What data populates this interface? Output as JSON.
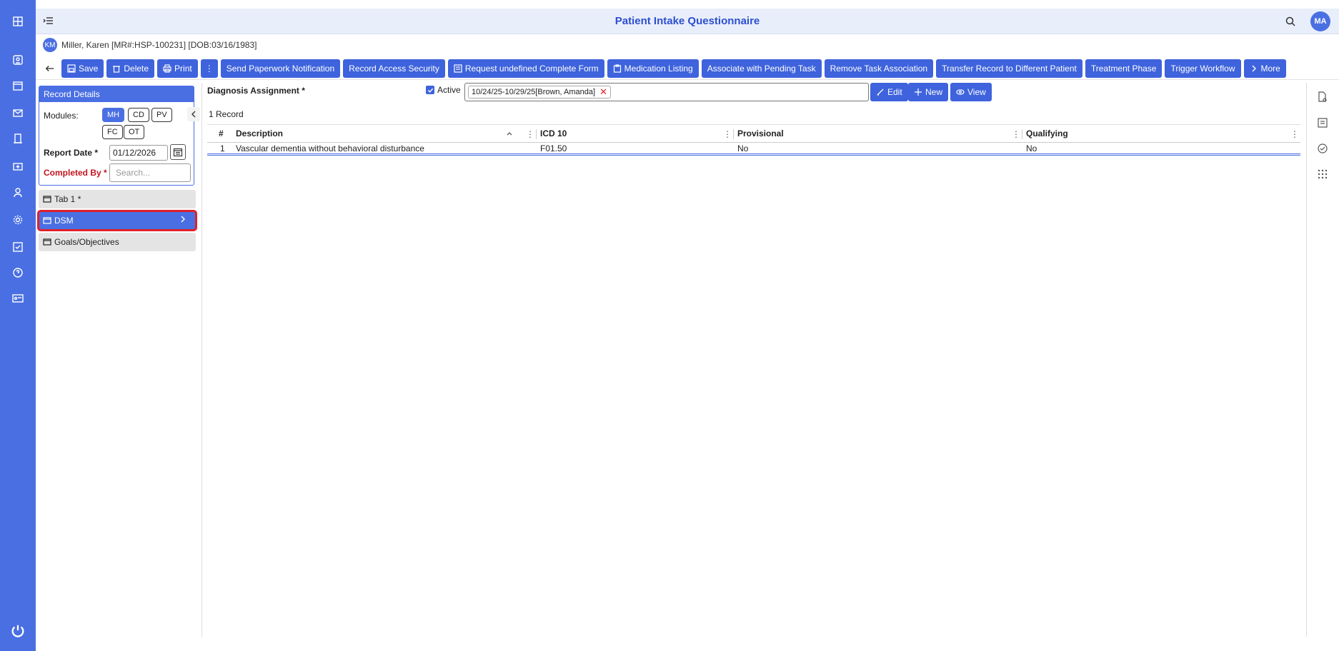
{
  "header": {
    "title": "Patient Intake Questionnaire",
    "user_initials": "MA"
  },
  "patient": {
    "initials": "KM",
    "label": "Miller, Karen [MR#:HSP-100231] [DOB:03/16/1983]"
  },
  "toolbar": {
    "save": "Save",
    "delete": "Delete",
    "print": "Print",
    "more_dots": "⋮",
    "buttons": [
      "Send Paperwork Notification",
      "Record Access Security",
      "Request undefined Complete Form",
      "Medication Listing",
      "Associate with Pending Task",
      "Remove Task Association",
      "Transfer Record to Different Patient",
      "Treatment Phase",
      "Trigger Workflow"
    ],
    "more": "More"
  },
  "record": {
    "header": "Record Details",
    "modules_label": "Modules:",
    "modules": [
      "MH",
      "CD",
      "PV",
      "FC",
      "OT"
    ],
    "report_date_label": "Report Date *",
    "report_date": "01/12/2026",
    "completed_by_label": "Completed By *",
    "completed_by_placeholder": "Search..."
  },
  "nav": {
    "tabs": [
      {
        "label": "Tab 1 *"
      },
      {
        "label": "DSM"
      },
      {
        "label": "Goals/Objectives"
      }
    ]
  },
  "diagnosis": {
    "label": "Diagnosis Assignment *",
    "active_label": "Active",
    "selected": "10/24/25-10/29/25[Brown, Amanda]",
    "edit": "Edit",
    "new": "New",
    "view": "View"
  },
  "grid": {
    "count": "1 Record",
    "columns": [
      "#",
      "Description",
      "ICD 10",
      "Provisional",
      "Qualifying"
    ],
    "rows": [
      {
        "num": "1",
        "description": "Vascular dementia without behavioral disturbance",
        "icd10": "F01.50",
        "provisional": "No",
        "qualifying": "No"
      }
    ]
  },
  "colors": {
    "accent": "#4a6fe3",
    "button": "#3e63dd",
    "highlight": "#e0202a",
    "title": "#2c4fd0"
  }
}
